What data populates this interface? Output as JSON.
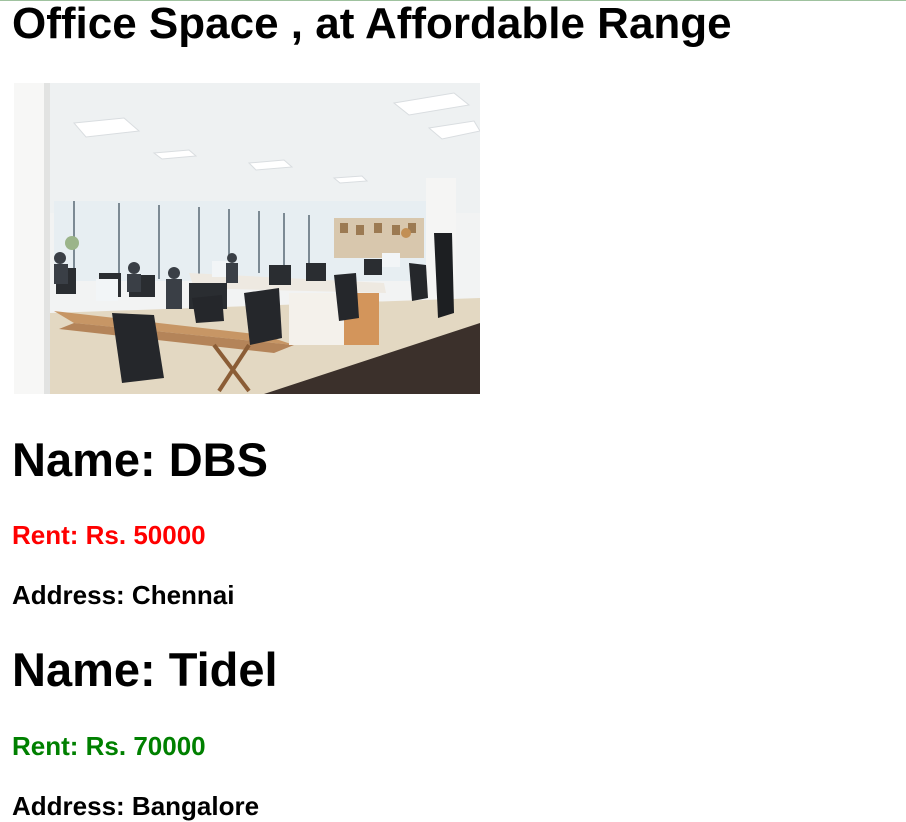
{
  "page": {
    "title": "Office Space , at Affordable Range"
  },
  "hero_image": {
    "alt": "open-plan office interior"
  },
  "offices": [
    {
      "name": "Name: DBS",
      "rent": "Rent: Rs. 50000",
      "address": "Address: Chennai",
      "rent_color": "#ff0000"
    },
    {
      "name": "Name: Tidel",
      "rent": "Rent: Rs. 70000",
      "address": "Address: Bangalore",
      "rent_color": "#008000"
    }
  ]
}
